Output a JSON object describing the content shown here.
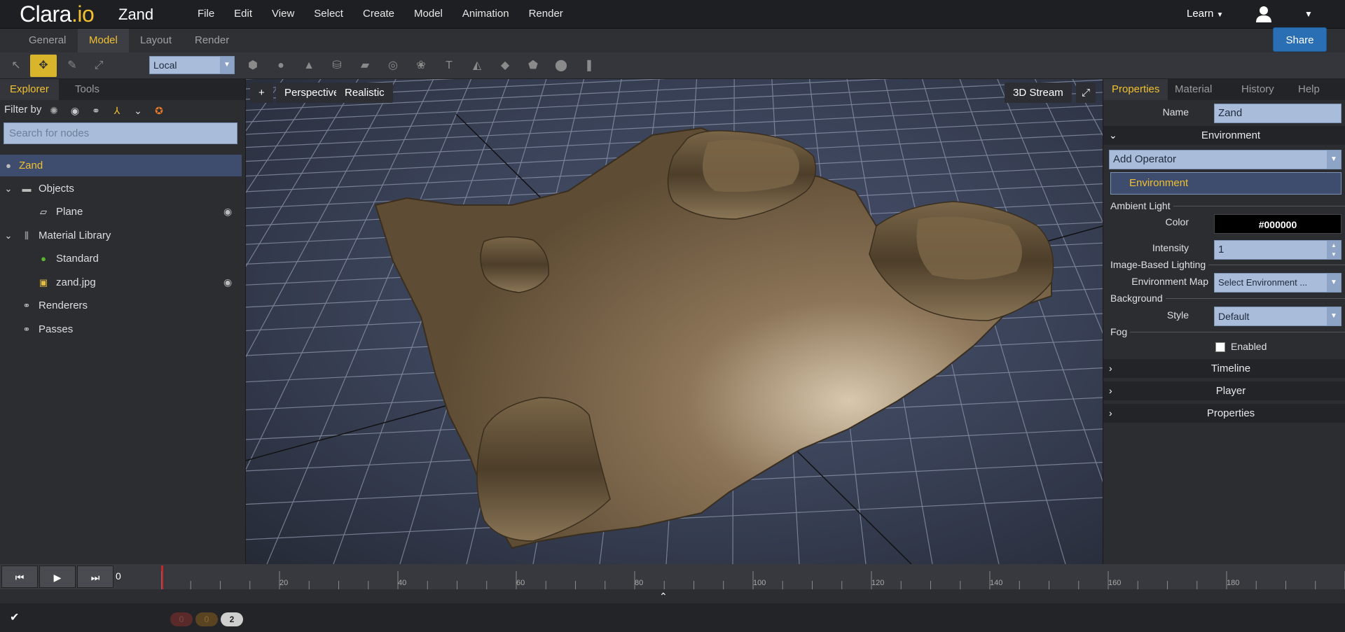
{
  "app": {
    "logo_main": "Clara",
    "logo_dot": ".io",
    "doc_title": "Zand"
  },
  "menu": [
    "File",
    "Edit",
    "View",
    "Select",
    "Create",
    "Model",
    "Animation",
    "Render"
  ],
  "learn_label": "Learn",
  "mode_tabs": [
    "General",
    "Model",
    "Layout",
    "Render"
  ],
  "active_mode": "Model",
  "share_label": "Share",
  "toolbar": {
    "coord_space": "Local"
  },
  "explorer": {
    "tabs": [
      "Explorer",
      "Tools"
    ],
    "filter_label": "Filter by",
    "search_placeholder": "Search for nodes",
    "tree": [
      {
        "label": "Zand",
        "icon": "sphere-icon"
      },
      {
        "label": "Objects",
        "icon": "folder-icon"
      },
      {
        "label": "Plane",
        "icon": "plane-icon"
      },
      {
        "label": "Material Library",
        "icon": "library-icon"
      },
      {
        "label": "Standard",
        "icon": "material-icon"
      },
      {
        "label": "zand.jpg",
        "icon": "image-icon"
      },
      {
        "label": "Renderers",
        "icon": "renderer-icon"
      },
      {
        "label": "Passes",
        "icon": "passes-icon"
      }
    ]
  },
  "viewport": {
    "plus": "+",
    "camera": "Perspective",
    "shading": "Realistic",
    "stream": "3D Stream"
  },
  "properties": {
    "tabs": [
      "Properties",
      "Material",
      "History",
      "Help"
    ],
    "name_label": "Name",
    "name_value": "Zand",
    "environment_section": "Environment",
    "add_operator": "Add Operator",
    "environment_item": "Environment",
    "ambient_light": "Ambient Light",
    "color_label": "Color",
    "color_value": "#000000",
    "intensity_label": "Intensity",
    "intensity_value": "1",
    "ibl": "Image-Based Lighting",
    "env_map_label": "Environment Map",
    "env_map_value": "Select Environment ...",
    "background": "Background",
    "style_label": "Style",
    "style_value": "Default",
    "fog": "Fog",
    "enabled_label": "Enabled",
    "collapsed_sections": [
      "Timeline",
      "Player",
      "Properties"
    ]
  },
  "timeline": {
    "current_frame": "0",
    "ticks": [
      "20",
      "40",
      "60",
      "80",
      "100",
      "120",
      "140",
      "160",
      "180"
    ]
  },
  "status": {
    "errors": "0",
    "warnings": "0",
    "info": "2"
  },
  "colors": {
    "accent": "#f0c030",
    "share": "#2a6eb3",
    "field": "#a9bddb"
  }
}
